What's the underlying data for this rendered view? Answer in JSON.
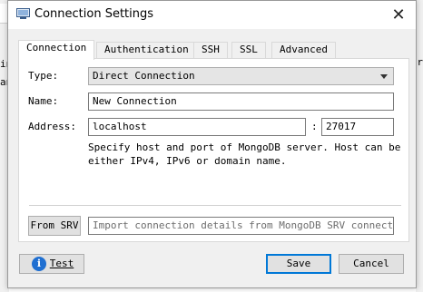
{
  "window": {
    "title": "Connection Settings",
    "close_glyph": "✕",
    "icon": "window-app-icon"
  },
  "tabs": [
    {
      "label": "Connection",
      "active": true
    },
    {
      "label": "Authentication",
      "active": false
    },
    {
      "label": "SSH",
      "active": false
    },
    {
      "label": "SSL",
      "active": false
    },
    {
      "label": "Advanced",
      "active": false
    }
  ],
  "connection": {
    "type_label": "Type:",
    "type_value": "Direct Connection",
    "name_label": "Name:",
    "name_value": "New Connection",
    "address_label": "Address:",
    "host_value": "localhost",
    "port_separator": ":",
    "port_value": "27017",
    "help_text": "Specify host and port of MongoDB server. Host can be\neither IPv4, IPv6 or domain name.",
    "srv_button": "From SRV",
    "srv_placeholder": "Import connection details from MongoDB SRV connection…"
  },
  "footer": {
    "test_button": "Test",
    "save_button": "Save",
    "cancel_button": "Cancel"
  },
  "background": {
    "left_chars": [
      "in",
      "an"
    ],
    "right_chars": "ar"
  },
  "colors": {
    "accent": "#0078d7",
    "info_icon": "#1f6fd1"
  }
}
